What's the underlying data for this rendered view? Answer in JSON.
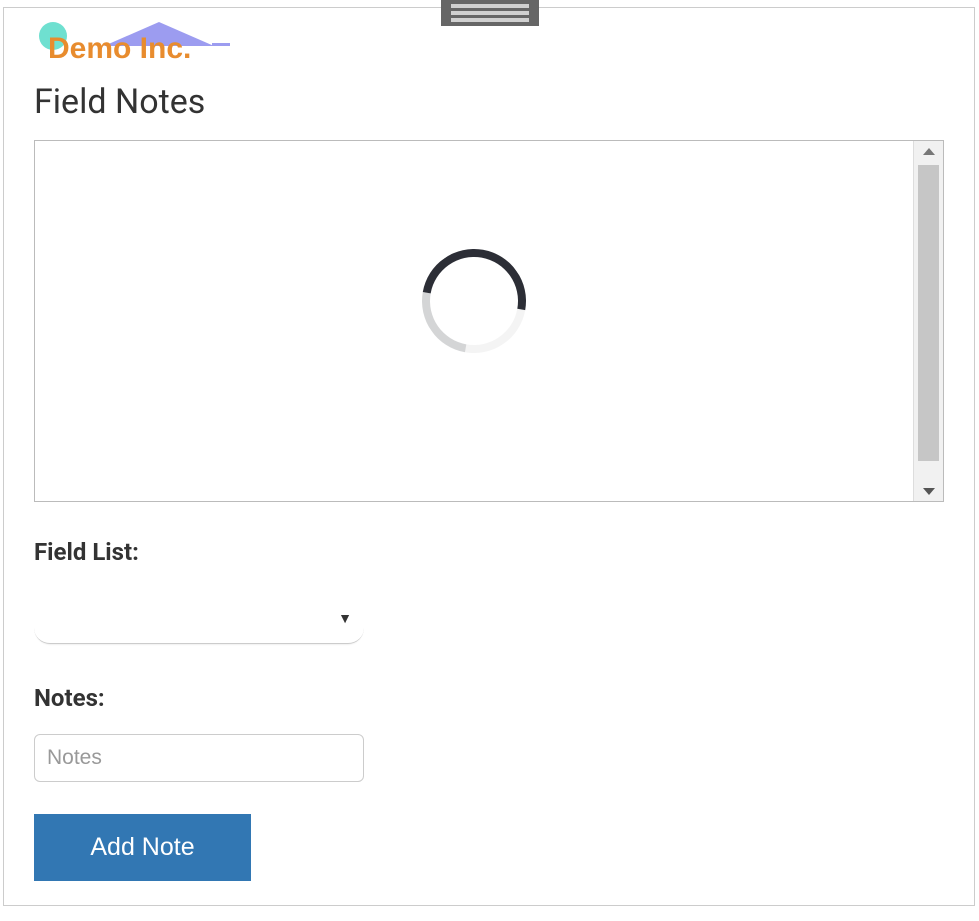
{
  "logo": {
    "text": "Demo Inc."
  },
  "header": {
    "title": "Field Notes"
  },
  "form": {
    "field_list_label": "Field List:",
    "field_list_value": "",
    "notes_label": "Notes:",
    "notes_placeholder": "Notes",
    "notes_value": "",
    "submit_label": "Add Note"
  },
  "icons": {
    "spinner": "loading-spinner",
    "caret": "▼"
  }
}
